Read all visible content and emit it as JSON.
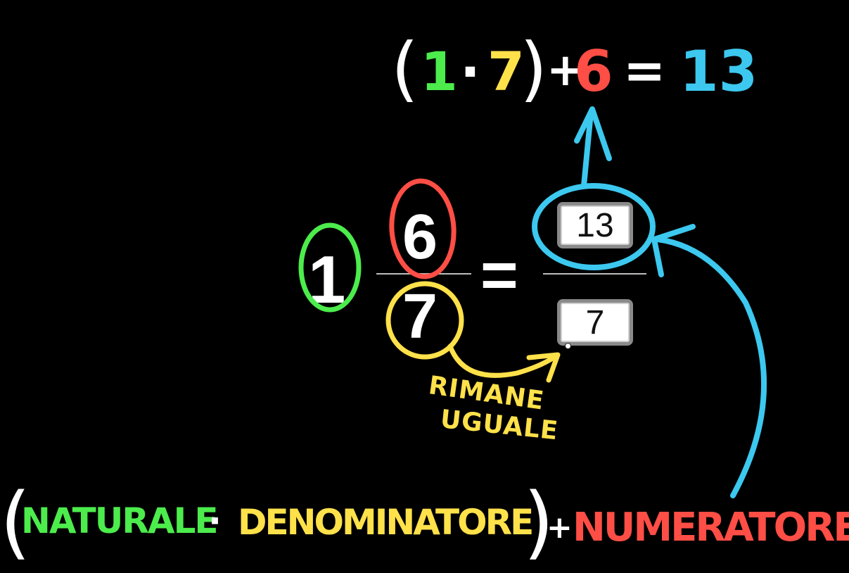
{
  "colors": {
    "background": "#000000",
    "white": "#ffffff",
    "green": "#4cec4c",
    "yellow": "#ffe14a",
    "red": "#ff4e45",
    "cyan": "#3cc8ef"
  },
  "formula_top": {
    "open_paren": "(",
    "natural": "1",
    "dot": "·",
    "denominator": "7",
    "close_paren": ")",
    "plus": "+",
    "numerator": "6",
    "equals": "=",
    "result": "13"
  },
  "mixed_number": {
    "whole": "1",
    "numerator": "6",
    "denominator": "7",
    "equals": "="
  },
  "answer": {
    "numerator_value": "13",
    "denominator_value": "7"
  },
  "note": {
    "line1": "RIMANE",
    "line2": "UGUALE"
  },
  "formula_bottom": {
    "open_paren": "(",
    "naturale": "NATURALE",
    "dot": "·",
    "denominatore": "DENOMINATORE",
    "close_paren": ")",
    "plus": "+",
    "numeratore": "NUMERATORE"
  },
  "icons": {
    "arrows": [
      "arrow-up-icon",
      "arrow-curved-right-icon",
      "arrow-curved-up-icon"
    ]
  }
}
